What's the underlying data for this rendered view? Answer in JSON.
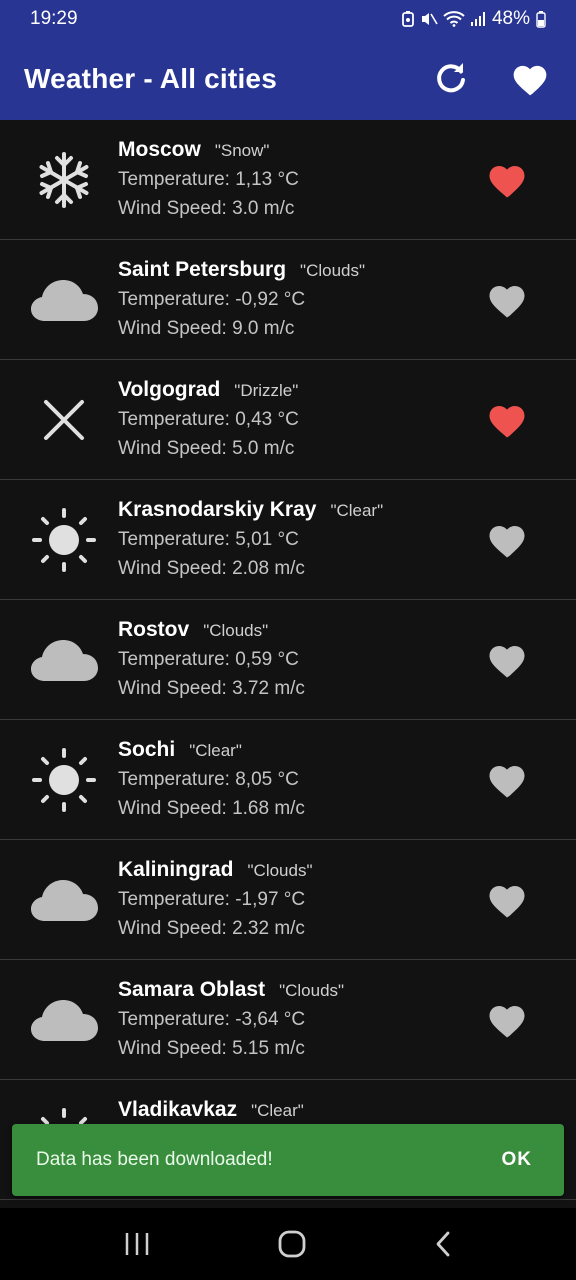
{
  "status": {
    "time": "19:29",
    "battery": "48%"
  },
  "app": {
    "title": "Weather - All cities",
    "refresh_icon": "refresh-icon",
    "favorites_icon": "heart-icon"
  },
  "colors": {
    "appbar": "#283593",
    "fav_on": "#ef5350",
    "fav_off": "#bdbdbd",
    "snackbar": "#388e3c"
  },
  "cities": [
    {
      "name": "Moscow",
      "condition": "\"Snow\"",
      "temperature": "Temperature: 1,13 °C",
      "wind": "Wind Speed: 3.0 m/c",
      "icon": "snow-icon",
      "favorite": true
    },
    {
      "name": "Saint Petersburg",
      "condition": "\"Clouds\"",
      "temperature": "Temperature: -0,92 °C",
      "wind": "Wind Speed: 9.0 m/c",
      "icon": "cloud-icon",
      "favorite": false
    },
    {
      "name": "Volgograd",
      "condition": "\"Drizzle\"",
      "temperature": "Temperature: 0,43 °C",
      "wind": "Wind Speed: 5.0 m/c",
      "icon": "drizzle-icon",
      "favorite": true
    },
    {
      "name": "Krasnodarskiy Kray",
      "condition": "\"Clear\"",
      "temperature": "Temperature: 5,01 °C",
      "wind": "Wind Speed: 2.08 m/c",
      "icon": "sun-icon",
      "favorite": false
    },
    {
      "name": "Rostov",
      "condition": "\"Clouds\"",
      "temperature": "Temperature: 0,59 °C",
      "wind": "Wind Speed: 3.72 m/c",
      "icon": "cloud-icon",
      "favorite": false
    },
    {
      "name": "Sochi",
      "condition": "\"Clear\"",
      "temperature": "Temperature: 8,05 °C",
      "wind": "Wind Speed: 1.68 m/c",
      "icon": "sun-icon",
      "favorite": false
    },
    {
      "name": "Kaliningrad",
      "condition": "\"Clouds\"",
      "temperature": "Temperature: -1,97 °C",
      "wind": "Wind Speed: 2.32 m/c",
      "icon": "cloud-icon",
      "favorite": false
    },
    {
      "name": "Samara Oblast",
      "condition": "\"Clouds\"",
      "temperature": "Temperature: -3,64 °C",
      "wind": "Wind Speed: 5.15 m/c",
      "icon": "cloud-icon",
      "favorite": false
    },
    {
      "name": "Vladikavkaz",
      "condition": "\"Clear\"",
      "temperature": "",
      "wind": "",
      "icon": "sun-icon",
      "favorite": true
    }
  ],
  "snackbar": {
    "message": "Data has been downloaded!",
    "action": "OK"
  },
  "navigation": {
    "recents_icon": "recents-icon",
    "home_icon": "home-icon",
    "back_icon": "back-icon"
  }
}
